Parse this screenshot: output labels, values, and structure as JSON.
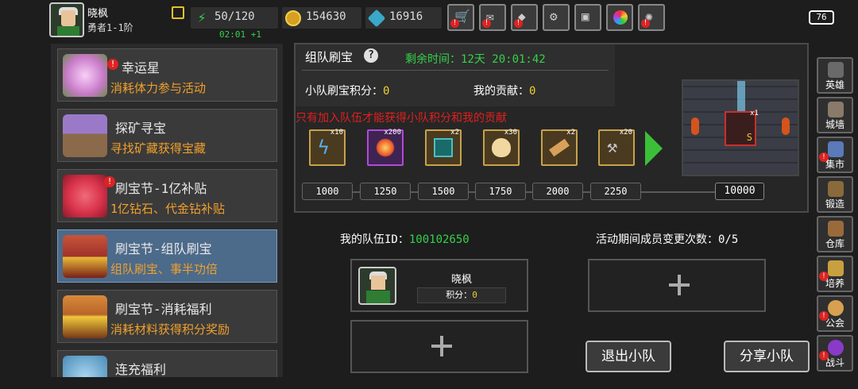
{
  "user": {
    "name": "晓枫",
    "rank": "勇者1-1阶"
  },
  "resources": {
    "stamina": "50/120",
    "timer": "02:01 +1",
    "gold": "154630",
    "gems": "16916"
  },
  "toolbar": {
    "icons": [
      "shop-cart-icon",
      "mail-icon",
      "gamepad-icon",
      "gear-icon",
      "gift-icon",
      "color-wheel-icon",
      "fireworks-icon"
    ]
  },
  "battery": "76",
  "events": [
    {
      "title": "幸运星",
      "desc": "消耗体力参与活动",
      "thumb": "#c87ac8"
    },
    {
      "title": "探矿寻宝",
      "desc": "寻找矿藏获得宝藏",
      "thumb": "#8a6a4a"
    },
    {
      "title": "刷宝节-1亿补贴",
      "desc": "1亿钻石、代金钻补贴",
      "thumb": "#d8324a"
    },
    {
      "title": "刷宝节-组队刷宝",
      "desc": "组队刷宝、事半功倍",
      "thumb": "#a0322a"
    },
    {
      "title": "刷宝节-消耗福利",
      "desc": "消耗材料获得积分奖励",
      "thumb": "#b8642a"
    },
    {
      "title": "连充福利",
      "desc": "",
      "thumb": "#4a8ab8"
    }
  ],
  "panel": {
    "title": "组队刷宝",
    "remaining": "剩余时间：12天 20:01:42",
    "team_points_label": "小队刷宝积分：",
    "team_points": "0",
    "my_contrib_label": "我的贡献：",
    "my_contrib": "0",
    "warning": "只有加入队伍才能获得小队积分和我的贡献"
  },
  "rewards": [
    {
      "qty": "x10",
      "name": "lightning-scroll-icon"
    },
    {
      "qty": "x200",
      "name": "fire-icon"
    },
    {
      "qty": "x2",
      "name": "spellbook-icon"
    },
    {
      "qty": "x30",
      "name": "egg-icon"
    },
    {
      "qty": "x2",
      "name": "scroll-icon"
    },
    {
      "qty": "x20",
      "name": "hammer-icon"
    }
  ],
  "milestones": [
    "1000",
    "1250",
    "1500",
    "1750",
    "2000",
    "2250",
    "10000"
  ],
  "final_reward_qty": "x1",
  "team": {
    "id_label": "我的队伍ID：",
    "id": "100102650",
    "changes": "活动期间成员变更次数：0/5",
    "member_name": "晓枫",
    "member_pts_label": "积分：",
    "member_pts": "0"
  },
  "buttons": {
    "leave": "退出小队",
    "share": "分享小队"
  },
  "sidebar": [
    {
      "label": "英雄",
      "badge": false
    },
    {
      "label": "城墙",
      "badge": false
    },
    {
      "label": "集市",
      "badge": true
    },
    {
      "label": "锻造",
      "badge": false
    },
    {
      "label": "仓库",
      "badge": false
    },
    {
      "label": "培养",
      "badge": true
    },
    {
      "label": "公会",
      "badge": true
    },
    {
      "label": "战斗",
      "badge": true
    }
  ]
}
